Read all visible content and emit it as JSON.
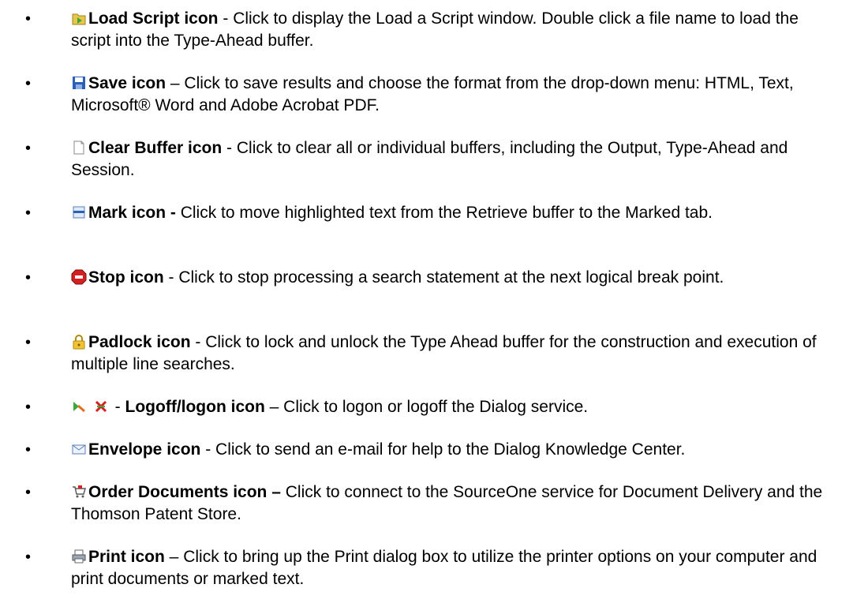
{
  "items": [
    {
      "icon": "load-script-icon",
      "title": "Load Script icon",
      "sep": " - ",
      "desc": "Click to display the Load a Script window. Double click a file name to load the script into the Type-Ahead buffer."
    },
    {
      "icon": "save-icon",
      "title": "Save icon",
      "sep": " – ",
      "desc": "Click to save results and choose the format from the drop-down menu: HTML, Text, Microsoft® Word and Adobe Acrobat PDF."
    },
    {
      "icon": "clear-buffer-icon",
      "title": "Clear Buffer icon",
      "sep": " - ",
      "desc": "Click to clear all or individual buffers, including the Output, Type-Ahead and Session."
    },
    {
      "icon": "mark-icon",
      "title": "Mark icon -",
      "sep": " ",
      "desc": "Click to move highlighted text from the Retrieve buffer to the Marked tab."
    },
    {
      "icon": "stop-icon",
      "title": "Stop icon",
      "sep": " - ",
      "desc": "Click to stop processing a search statement at the next logical break point."
    },
    {
      "icon": "padlock-icon",
      "title": "Padlock icon",
      "sep": " - ",
      "desc": "Click to lock and unlock the Type Ahead buffer for the construction and execution of multiple line searches."
    },
    {
      "icon": "logoff-logon-icon",
      "prefix": " - ",
      "title": "Logoff/logon icon",
      "sep": " – ",
      "desc": "Click to logon or logoff the Dialog service."
    },
    {
      "icon": "envelope-icon",
      "title": "Envelope icon",
      "sep": " - ",
      "desc": "Click to send an e-mail for help to the Dialog Knowledge Center."
    },
    {
      "icon": "order-documents-icon",
      "title": "Order Documents icon –",
      "sep": " ",
      "desc": "Click to connect to the SourceOne service for Document Delivery and the Thomson Patent Store."
    },
    {
      "icon": "print-icon",
      "title": "Print icon",
      "sep": " – ",
      "desc": "Click to bring up the Print dialog box to utilize the printer options on your computer and print documents or marked text."
    }
  ]
}
